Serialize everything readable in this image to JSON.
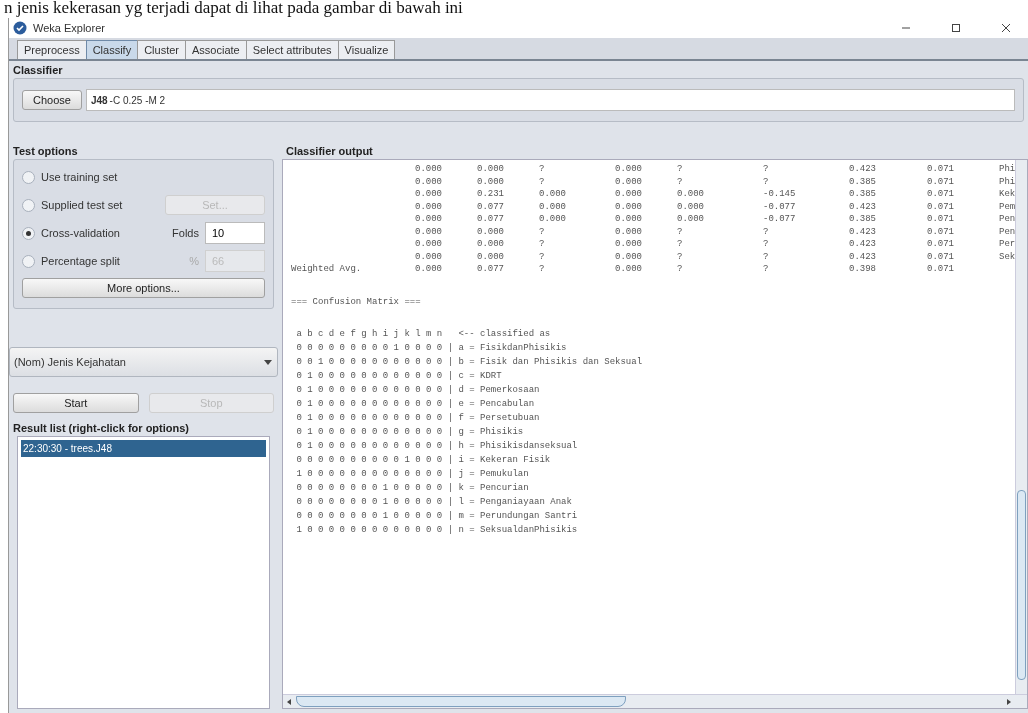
{
  "document_text": "n jenis kekerasan yg terjadi dapat di lihat pada gambar di bawah ini",
  "window": {
    "title": "Weka Explorer"
  },
  "tabs": [
    {
      "label": "Preprocess",
      "selected": false
    },
    {
      "label": "Classify",
      "selected": true
    },
    {
      "label": "Cluster",
      "selected": false
    },
    {
      "label": "Associate",
      "selected": false
    },
    {
      "label": "Select attributes",
      "selected": false
    },
    {
      "label": "Visualize",
      "selected": false
    }
  ],
  "classifier": {
    "heading": "Classifier",
    "button": "Choose",
    "name": "J48",
    "options": "-C 0.25 -M 2"
  },
  "test_options": {
    "heading": "Test options",
    "options": [
      {
        "label": "Use training set",
        "selected": false
      },
      {
        "label": "Supplied test set",
        "selected": false,
        "button": "Set...",
        "button_disabled": true
      },
      {
        "label": "Cross-validation",
        "selected": true,
        "field_label": "Folds",
        "value": "10",
        "field_disabled": false
      },
      {
        "label": "Percentage split",
        "selected": false,
        "field_label": "%",
        "value": "66",
        "field_disabled": true
      }
    ],
    "more_button": "More options..."
  },
  "class_attribute": "(Nom) Jenis Kejahatan",
  "start_button": {
    "label": "Start",
    "disabled": false
  },
  "stop_button": {
    "label": "Stop",
    "disabled": true
  },
  "result_list": {
    "heading": "Result list (right-click for options)",
    "items": [
      {
        "label": "22:30:30 - trees.J48",
        "selected": true
      }
    ]
  },
  "output": {
    "heading": "Classifier output",
    "stats_rows": [
      {
        "label": "",
        "cells": [
          "0.000",
          "0.000",
          "?",
          "0.000",
          "?",
          "?",
          "0.423",
          "0.071",
          "Phi"
        ]
      },
      {
        "label": "",
        "cells": [
          "0.000",
          "0.000",
          "?",
          "0.000",
          "?",
          "?",
          "0.385",
          "0.071",
          "Phi"
        ]
      },
      {
        "label": "",
        "cells": [
          "0.000",
          "0.231",
          "0.000",
          "0.000",
          "0.000",
          "-0.145",
          "0.385",
          "0.071",
          "Kek"
        ]
      },
      {
        "label": "",
        "cells": [
          "0.000",
          "0.077",
          "0.000",
          "0.000",
          "0.000",
          "-0.077",
          "0.423",
          "0.071",
          "Pem"
        ]
      },
      {
        "label": "",
        "cells": [
          "0.000",
          "0.077",
          "0.000",
          "0.000",
          "0.000",
          "-0.077",
          "0.385",
          "0.071",
          "Pen"
        ]
      },
      {
        "label": "",
        "cells": [
          "0.000",
          "0.000",
          "?",
          "0.000",
          "?",
          "?",
          "0.423",
          "0.071",
          "Pen"
        ]
      },
      {
        "label": "",
        "cells": [
          "0.000",
          "0.000",
          "?",
          "0.000",
          "?",
          "?",
          "0.423",
          "0.071",
          "Per"
        ]
      },
      {
        "label": "",
        "cells": [
          "0.000",
          "0.000",
          "?",
          "0.000",
          "?",
          "?",
          "0.423",
          "0.071",
          "Sek"
        ]
      },
      {
        "label": "Weighted Avg.",
        "cells": [
          "0.000",
          "0.077",
          "?",
          "0.000",
          "?",
          "?",
          "0.398",
          "0.071"
        ]
      }
    ],
    "matrix_title": "=== Confusion Matrix ===",
    "matrix_header": " a b c d e f g h i j k l m n   <-- classified as",
    "matrix_rows": [
      " 0 0 0 0 0 0 0 0 0 1 0 0 0 0 | a = FisikdanPhisikis",
      " 0 0 1 0 0 0 0 0 0 0 0 0 0 0 | b = Fisik dan Phisikis dan Seksual",
      " 0 1 0 0 0 0 0 0 0 0 0 0 0 0 | c = KDRT",
      " 0 1 0 0 0 0 0 0 0 0 0 0 0 0 | d = Pemerkosaan",
      " 0 1 0 0 0 0 0 0 0 0 0 0 0 0 | e = Pencabulan",
      " 0 1 0 0 0 0 0 0 0 0 0 0 0 0 | f = Persetubuan",
      " 0 1 0 0 0 0 0 0 0 0 0 0 0 0 | g = Phisikis",
      " 0 1 0 0 0 0 0 0 0 0 0 0 0 0 | h = Phisikisdanseksual",
      " 0 0 0 0 0 0 0 0 0 0 1 0 0 0 | i = Kekeran Fisik",
      " 1 0 0 0 0 0 0 0 0 0 0 0 0 0 | j = Pemukulan",
      " 0 0 0 0 0 0 0 0 1 0 0 0 0 0 | k = Pencurian",
      " 0 0 0 0 0 0 0 0 1 0 0 0 0 0 | l = Penganiayaan Anak",
      " 0 0 0 0 0 0 0 0 1 0 0 0 0 0 | m = Perundungan Santri",
      " 1 0 0 0 0 0 0 0 0 0 0 0 0 0 | n = SeksualdanPhisikis"
    ]
  }
}
